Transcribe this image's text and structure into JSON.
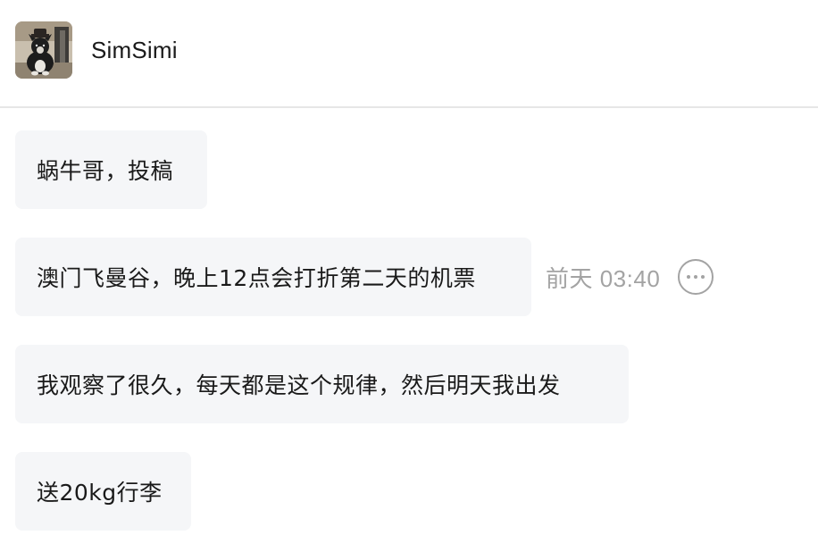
{
  "header": {
    "contact_name": "SimSimi",
    "avatar_icon": "dog-avatar"
  },
  "messages": [
    {
      "text": "蜗牛哥，投稿"
    },
    {
      "text": "澳门飞曼谷，晚上12点会打折第二天的机票",
      "timestamp": "前天 03:40",
      "more_icon": "more-horizontal-icon"
    },
    {
      "text": "我观察了很久，每天都是这个规律，然后明天我出发"
    },
    {
      "text": "送20kg行李"
    }
  ],
  "colors": {
    "bubble_bg": "#f5f6f8",
    "text": "#1a1a1a",
    "meta_gray": "#a3a3a3",
    "divider": "#e6e6e6"
  }
}
